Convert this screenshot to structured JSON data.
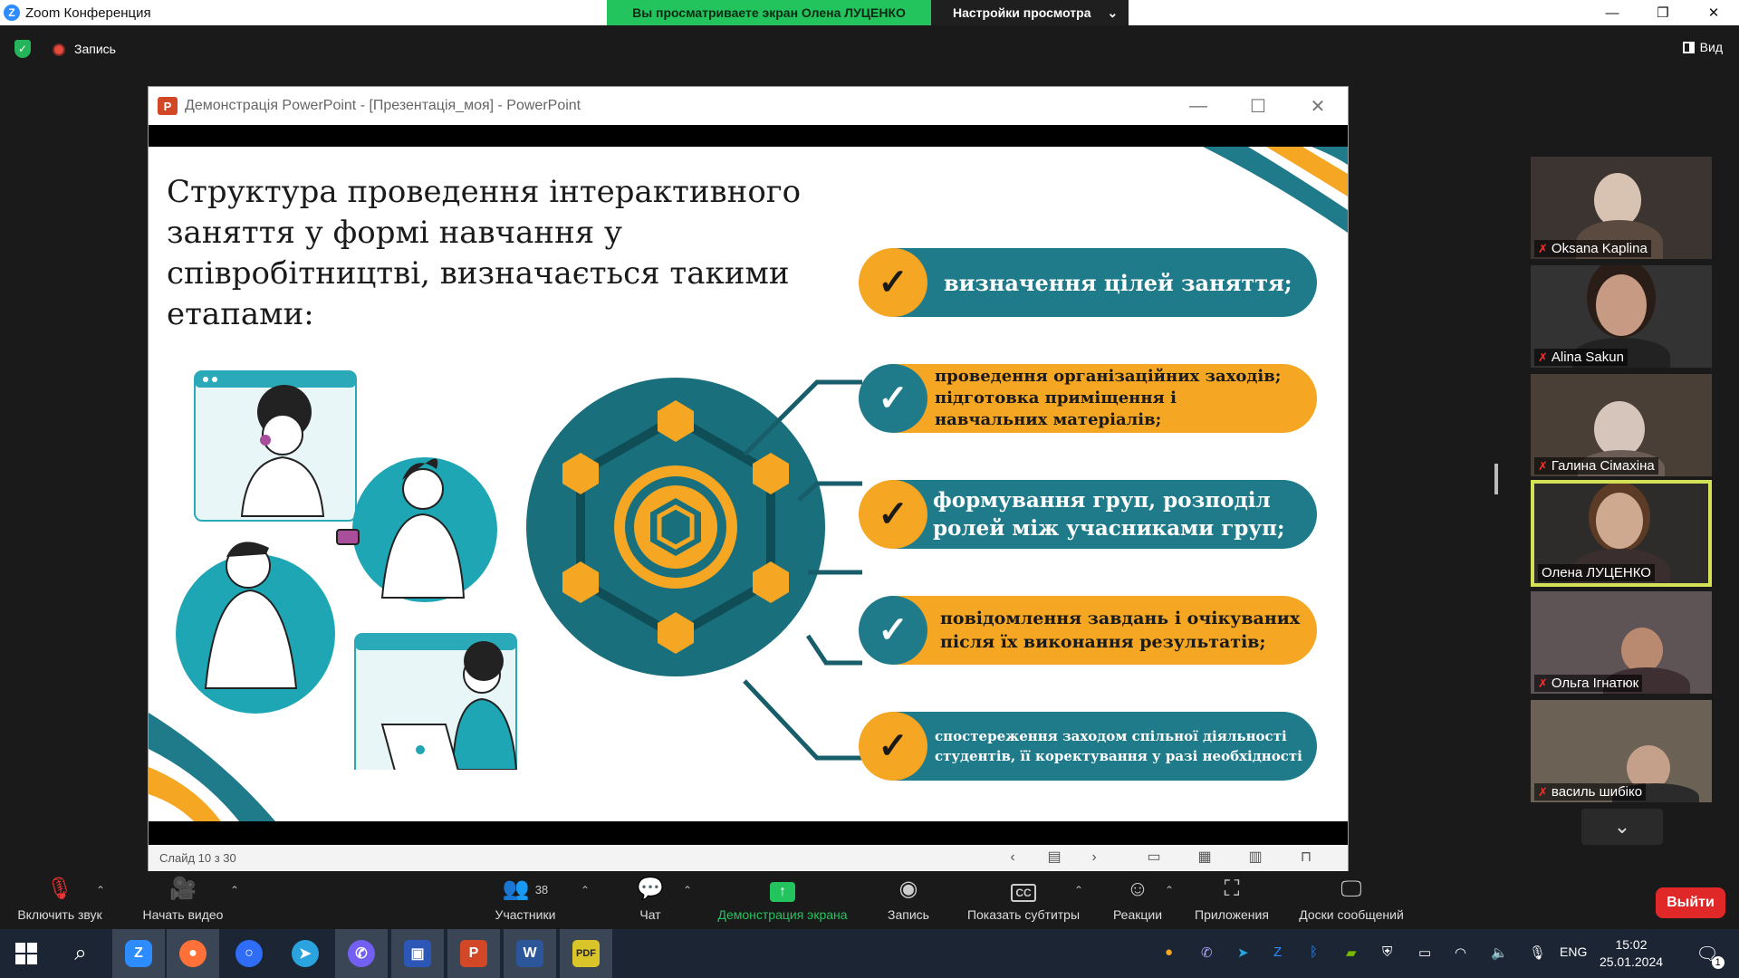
{
  "window": {
    "app_title": "Zoom Конференция",
    "share_banner": "Вы просматриваете экран Олена ЛУЦЕНКО",
    "view_settings": "Настройки просмотра",
    "controls": {
      "minimize": "—",
      "restore": "❐",
      "close": "✕"
    }
  },
  "topbar": {
    "record_label": "Запись",
    "view_label": "Вид"
  },
  "powerpoint": {
    "title": "Демонстрація PowerPoint - [Презентація_моя] - PowerPoint",
    "status": "Слайд 10 з 30",
    "controls": {
      "minimize": "—",
      "maximize": "☐",
      "close": "✕"
    }
  },
  "slide": {
    "title": "Структура проведення інтерактивного заняття у формі навчання у співробітництві, визначається такими етапами:",
    "stages": [
      {
        "text": "визначення цілей заняття;",
        "bar_color": "#1f7a8a",
        "check_color": "#f5a623"
      },
      {
        "text": "проведення організаційних заходів; підготовка приміщення і навчальних матеріалів;",
        "bar_color": "#f5a623",
        "check_color": "#1f7a8a"
      },
      {
        "text": "формування груп, розподіл ролей між учасниками груп;",
        "bar_color": "#1f7a8a",
        "check_color": "#f5a623"
      },
      {
        "text": "повідомлення завдань і очікуваних після їх виконання результатів;",
        "bar_color": "#f5a623",
        "check_color": "#1f7a8a"
      },
      {
        "text": "спостереження заходом спільної діяльності студентів, її коректування у разі необхідності",
        "bar_color": "#1f7a8a",
        "check_color": "#f5a623"
      }
    ],
    "colors": {
      "teal": "#1f7a8a",
      "teal_dark": "#175e6a",
      "orange": "#f5a623"
    }
  },
  "participants": [
    {
      "name": "Oksana Kaplina",
      "muted": true,
      "active": false
    },
    {
      "name": "Alina Sakun",
      "muted": true,
      "active": false
    },
    {
      "name": "Галина Сімахіна",
      "muted": true,
      "active": false
    },
    {
      "name": "Олена ЛУЦЕНКО",
      "muted": false,
      "active": true
    },
    {
      "name": "Ольга Ігнатюк",
      "muted": true,
      "active": false
    },
    {
      "name": "василь шибіко",
      "muted": true,
      "active": false
    }
  ],
  "toolbar": {
    "unmute": "Включить звук",
    "start_video": "Начать видео",
    "participants": "Участники",
    "participants_count": "38",
    "chat": "Чат",
    "share_screen": "Демонстрация экрана",
    "record": "Запись",
    "captions": "Показать субтитры",
    "reactions": "Реакции",
    "apps": "Приложения",
    "whiteboards": "Доски сообщений",
    "leave": "Выйти"
  },
  "taskbar": {
    "lang": "ENG",
    "time": "15:02",
    "date": "25.01.2024",
    "notifications": "1"
  }
}
